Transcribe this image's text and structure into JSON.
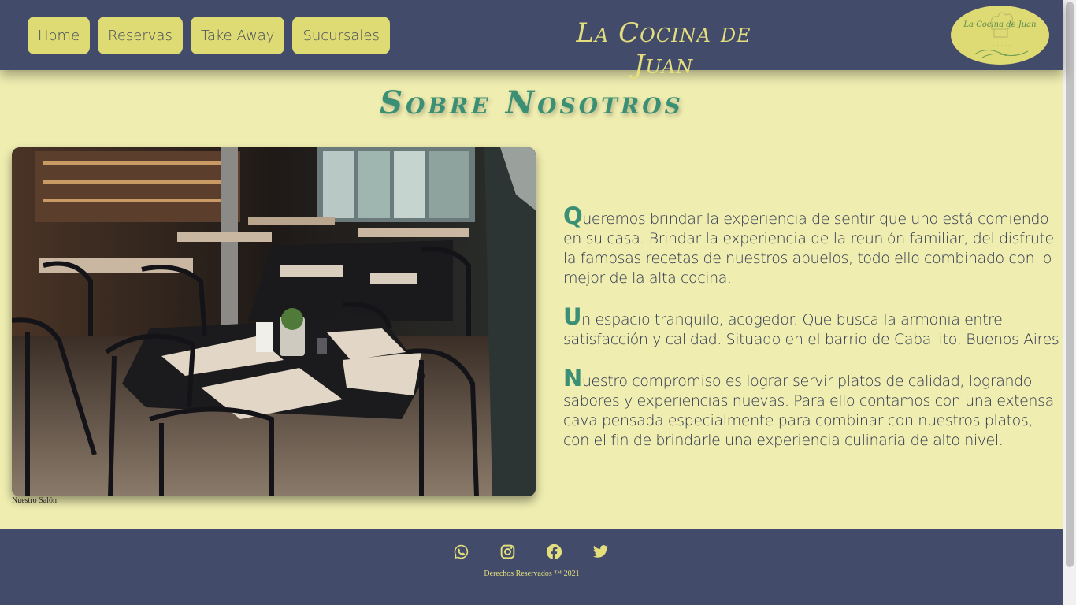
{
  "nav": {
    "items": [
      {
        "label": "Home"
      },
      {
        "label": "Reservas"
      },
      {
        "label": "Take Away"
      },
      {
        "label": "Sucursales"
      }
    ]
  },
  "header": {
    "brand": "La Cocina de Juan",
    "logo_text": "La Cocina de Juan",
    "logo_icon": "chef-hat-icon"
  },
  "main": {
    "title": "Sobre Nosotros",
    "photo_caption": "Nuestro Salón",
    "paragraphs": [
      {
        "initial": "Q",
        "text": "ueremos brindar la experiencia de sentir que uno está comiendo en su casa. Brindar la experiencia de la reunión familiar, del disfrute la famosas recetas de nuestros abuelos, todo ello combinado con lo mejor de la alta cocina."
      },
      {
        "initial": "U",
        "text": "n espacio tranquilo, acogedor. Que busca la armonia entre satisfacción y calidad. Situado en el barrio de Caballito, Buenos Aires"
      },
      {
        "initial": "N",
        "text": "uestro compromiso es lograr servir platos de calidad, logrando sabores y experiencias nuevas. Para ello contamos con una extensa cava pensada especialmente para combinar con nuestros platos, con el fin de brindarle una experiencia culinaria de alto nivel."
      }
    ]
  },
  "footer": {
    "social_icons": [
      "whatsapp-icon",
      "instagram-icon",
      "facebook-icon",
      "twitter-icon"
    ],
    "copyright": "Derechos Reservados ™ 2021"
  },
  "colors": {
    "header_bg": "#434b6b",
    "page_bg": "#efedb0",
    "button_bg": "#dedb74",
    "accent_text": "#e4df7c",
    "title_green": "#3a8f74"
  }
}
